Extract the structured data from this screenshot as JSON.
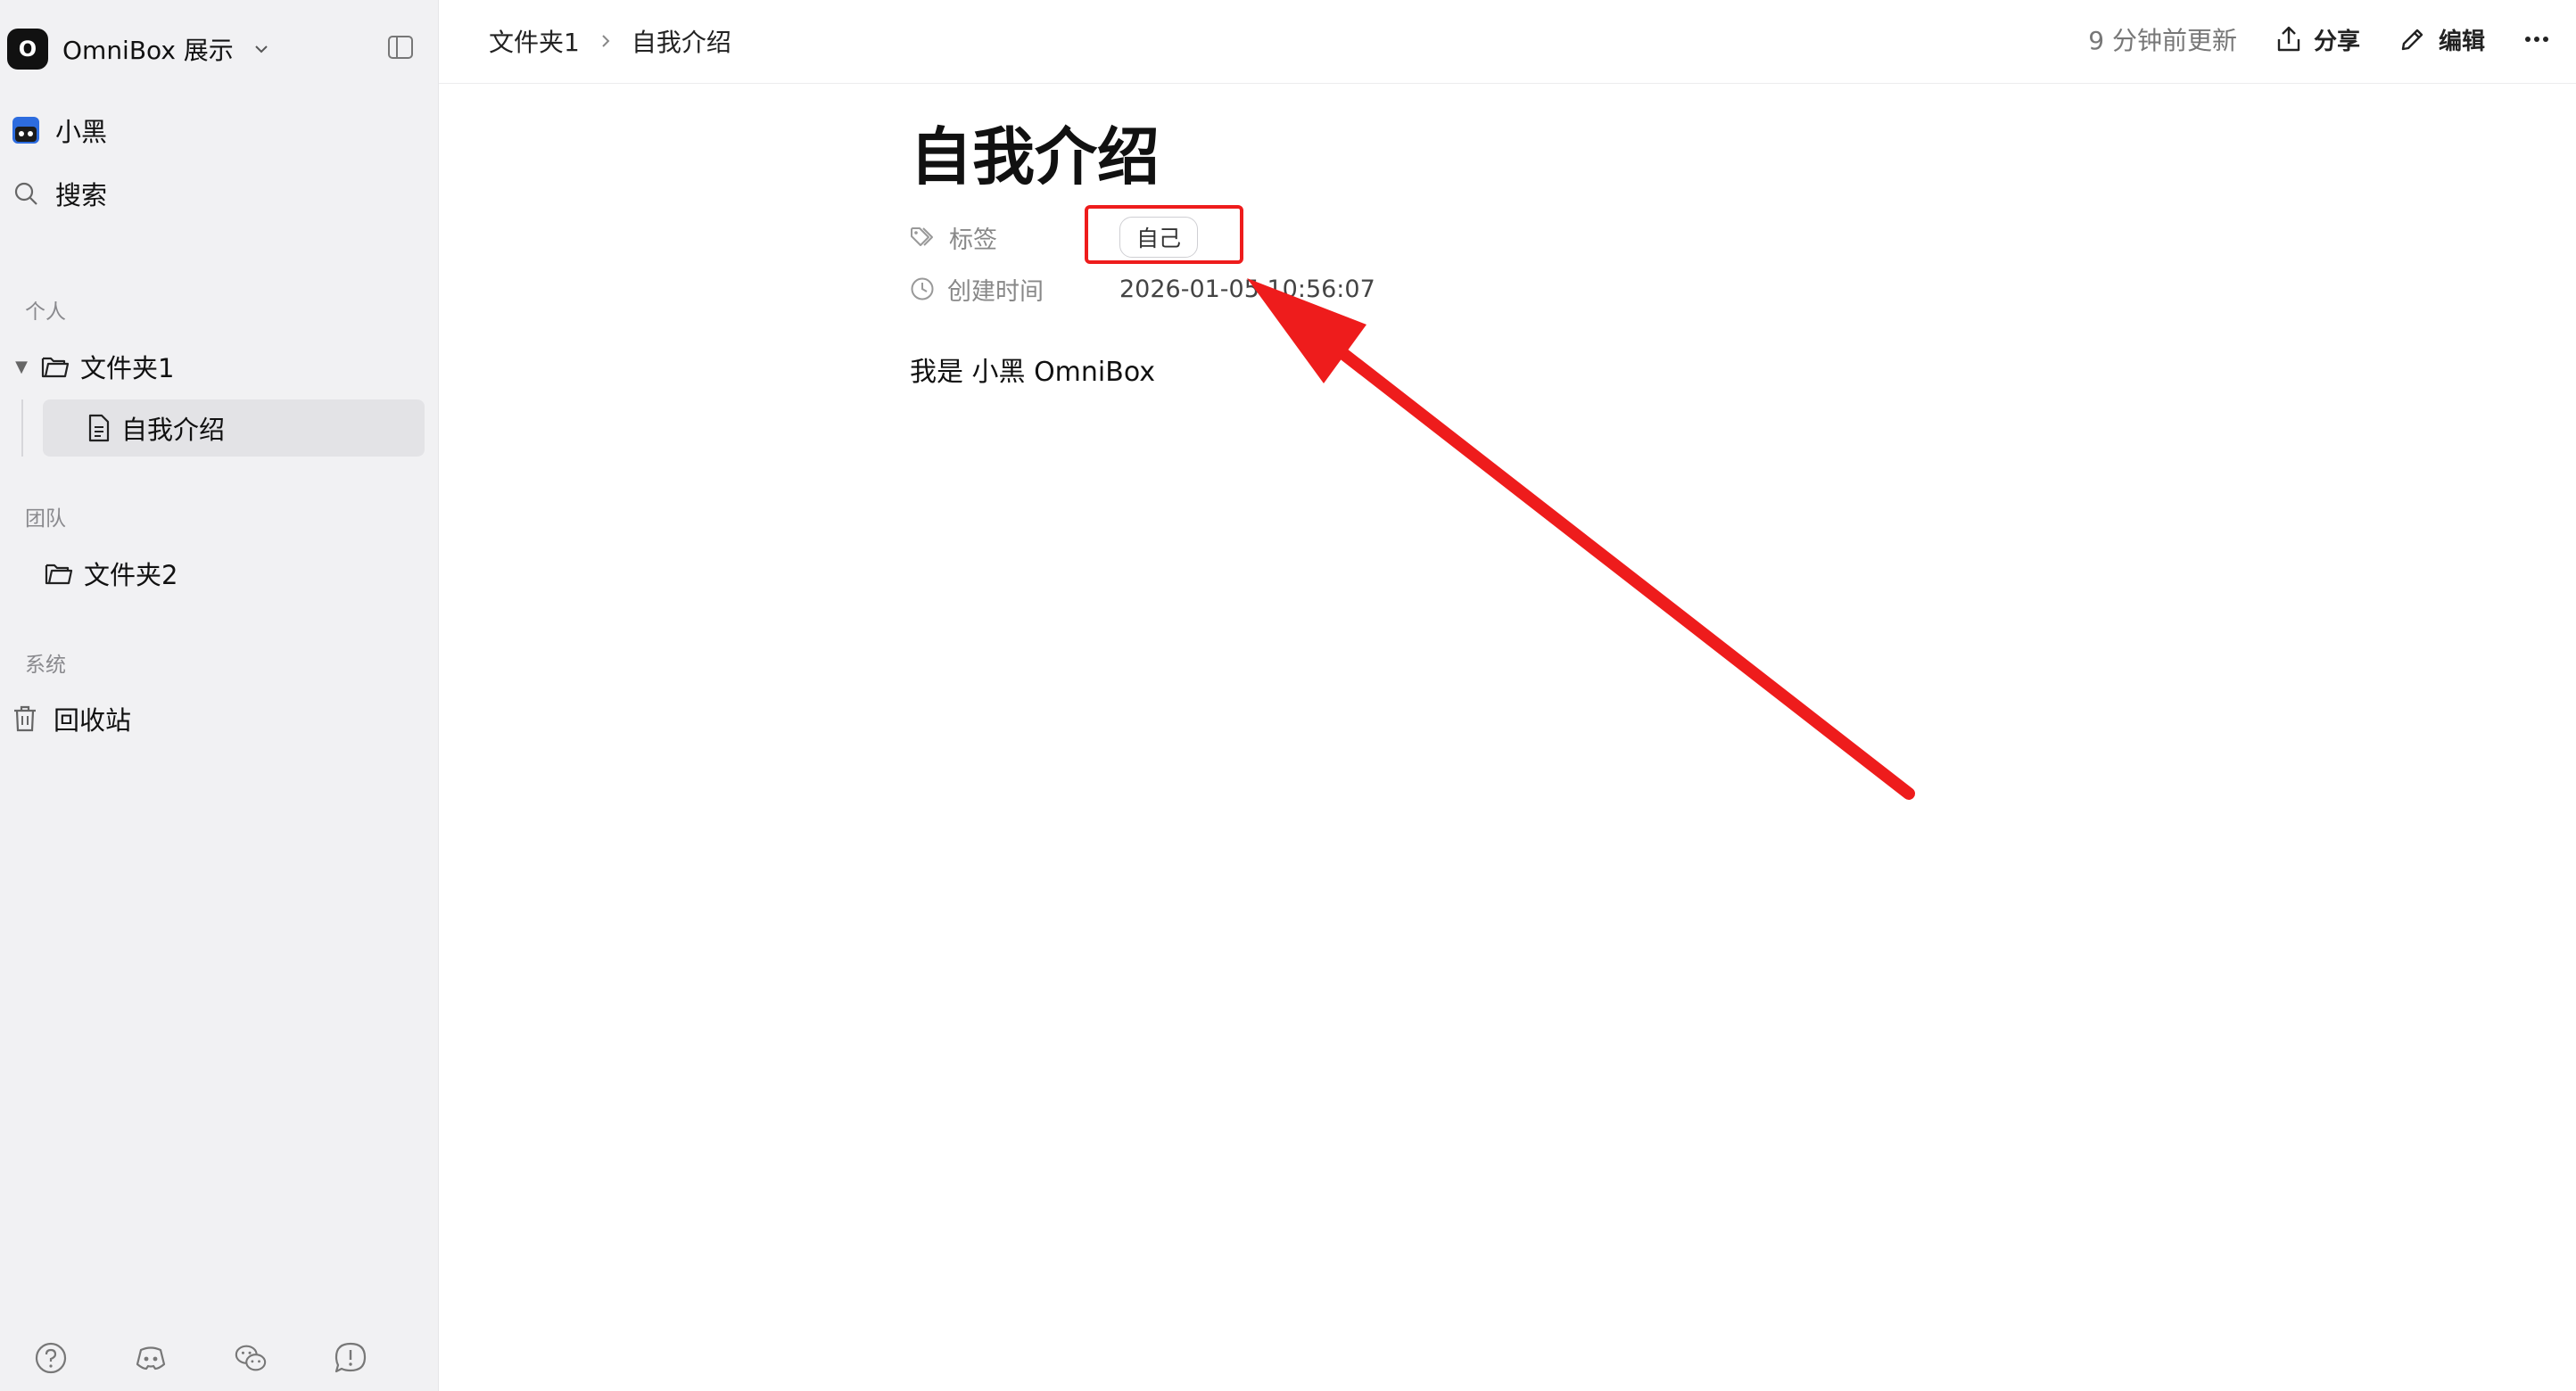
{
  "workspace": {
    "logo_letter": "O",
    "name": "OmniBox 展示"
  },
  "sidebar": {
    "user": "小黑",
    "search": "搜索",
    "sections": {
      "personal": "个人",
      "team": "团队",
      "system": "系统"
    },
    "tree": {
      "folder1": "文件夹1",
      "folder1_child": "自我介绍",
      "folder2": "文件夹2"
    },
    "trash": "回收站"
  },
  "topbar": {
    "breadcrumb": [
      "文件夹1",
      "自我介绍"
    ],
    "updated": "9 分钟前更新",
    "share": "分享",
    "edit": "编辑"
  },
  "document": {
    "title": "自我介绍",
    "properties": {
      "tags_label": "标签",
      "tag_value": "自己",
      "created_label": "创建时间",
      "created_value": "2026-01-05 10:56:07"
    },
    "body": "我是 小黑 OmniBox"
  },
  "colors": {
    "sidebar_bg": "#f1f1f3",
    "selected_bg": "#e3e3e6",
    "annotation_red": "#ee1c1c"
  }
}
